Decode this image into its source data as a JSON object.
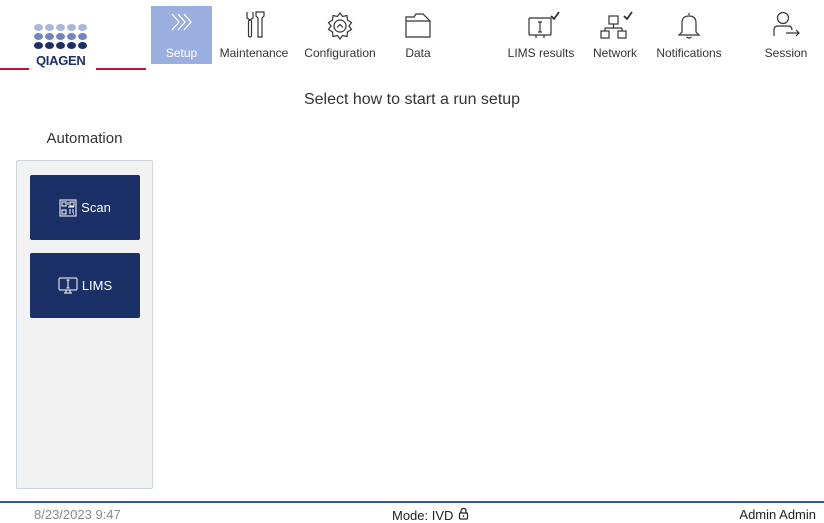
{
  "brand": {
    "logo_text": "QIAGEN",
    "colors": {
      "navy": "#1b3067",
      "light_blue": "#a9b7dc",
      "red": "#c8102e",
      "active_tab": "#9aaee0",
      "footer_line": "#2a5aa8"
    },
    "logo_icon": "qiagen-dots-logo"
  },
  "nav": {
    "items": [
      {
        "label": "Setup",
        "icon": "chevrons-right-icon",
        "active": true
      },
      {
        "label": "Maintenance",
        "icon": "tools-icon",
        "active": false
      },
      {
        "label": "Configuration",
        "icon": "gear-icon",
        "active": false
      },
      {
        "label": "Data",
        "icon": "folder-icon",
        "active": false
      },
      {
        "label": "LIMS results",
        "icon": "lims-monitor-check-icon",
        "active": false
      },
      {
        "label": "Network",
        "icon": "network-check-icon",
        "active": false
      },
      {
        "label": "Notifications",
        "icon": "bell-icon",
        "active": false
      },
      {
        "label": "Session",
        "icon": "user-logout-icon",
        "active": false
      }
    ]
  },
  "main": {
    "headline": "Select how to start a run setup",
    "automation": {
      "title": "Automation",
      "buttons": [
        {
          "label": "Scan",
          "icon": "barcode-scan-icon"
        },
        {
          "label": "LIMS",
          "icon": "monitor-icon"
        }
      ]
    }
  },
  "footer": {
    "datetime": "8/23/2023 9:47",
    "mode": "Mode: IVD",
    "mode_icon": "lock-icon",
    "user": "Admin Admin"
  }
}
